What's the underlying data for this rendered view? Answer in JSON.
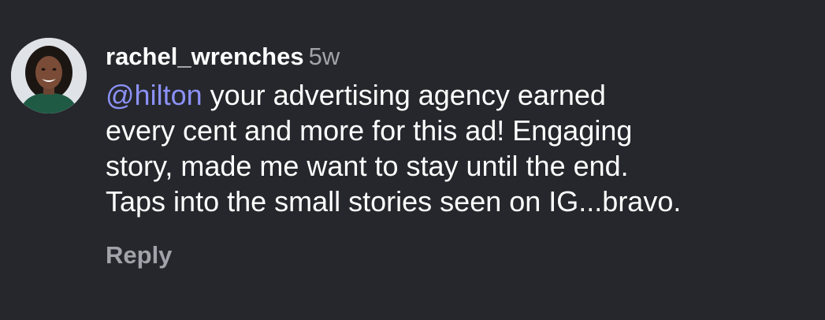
{
  "comment": {
    "username": "rachel_wrenches",
    "time": "5w",
    "mention": "@hilton",
    "lines": [
      " your advertising agency earned",
      "every cent and more for this ad! Engaging",
      "story, made me want to stay until the end.",
      "Taps into the small stories seen on IG...bravo."
    ],
    "reply_label": "Reply"
  },
  "colors": {
    "background": "#25272c",
    "mention": "#8c91f7",
    "secondary_text": "#a0a3a9"
  },
  "icons": {
    "avatar": "user-avatar-photo"
  }
}
